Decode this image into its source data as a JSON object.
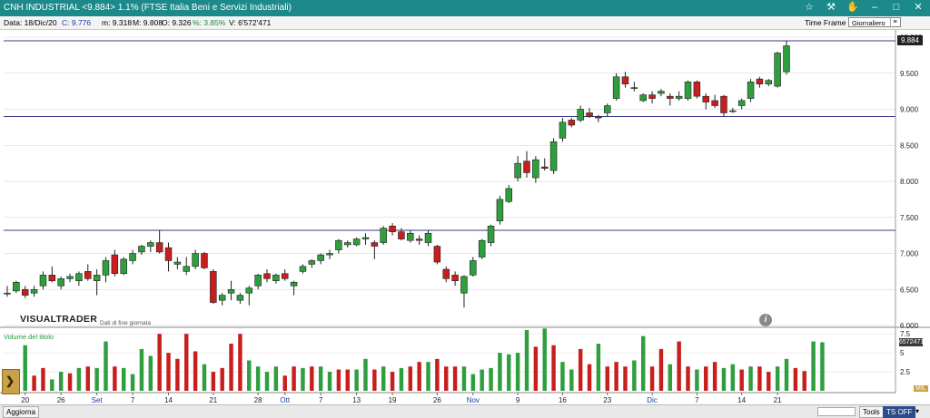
{
  "window": {
    "title": "CNH INDUSTRIAL <9.884> 1.1%  (FTSE Italia Beni e Servizi Industriali)"
  },
  "info": {
    "date_label": "Data: 18/Dic/20",
    "close_label": "C: 9.776",
    "min_label": "m: 9.318",
    "max_label": "M: 9.808",
    "open_label": "O: 9.326",
    "pct_label": "%: 3.85%",
    "vol_label": "V: 6'572'471",
    "time_frame_label": "Time Frame",
    "time_frame_value": "Giornaliero"
  },
  "overlay": {
    "logo": "VISUALTRADER",
    "logo_sub": "Dati di fine giornata",
    "info_icon": "i",
    "volume_title": "Volume del titolo",
    "last_price": "9.884",
    "last_volume": "6572471",
    "mil_label": "MIL"
  },
  "bottom": {
    "update_label": "Aggiorna",
    "tools_label": "Tools",
    "tsoff_label": "TS OFF"
  },
  "icons": {
    "star": "star-icon",
    "hammer": "hammer-icon",
    "hand": "hand-icon",
    "minimize": "minimize-icon",
    "maximize": "maximize-icon",
    "close": "close-icon"
  },
  "colors": {
    "up": "#2e9e3e",
    "down": "#c81e1e",
    "titlebar": "#1c8a8a",
    "hline": "#3a3a8a"
  },
  "chart_data": [
    {
      "type": "candlestick",
      "title": "",
      "ylim": [
        6.0,
        10.0
      ],
      "y_ticks": [
        "10.000",
        "9.500",
        "9.000",
        "8.500",
        "8.000",
        "7.500",
        "7.000",
        "6.500",
        "6.000"
      ],
      "y_tick_values": [
        10.0,
        9.5,
        9.0,
        8.5,
        8.0,
        7.5,
        7.0,
        6.5,
        6.0
      ],
      "horizontal_lines": [
        9.95,
        8.9,
        7.32
      ],
      "x_tick_labels": [
        "20",
        "26",
        "Set",
        "7",
        "14",
        "21",
        "28",
        "Ott",
        "7",
        "13",
        "19",
        "26",
        "Nov",
        "9",
        "16",
        "23",
        "Dic",
        "7",
        "14",
        "21"
      ],
      "x_tick_index": [
        2,
        6,
        10,
        14,
        18,
        23,
        28,
        31,
        35,
        39,
        43,
        48,
        52,
        57,
        62,
        67,
        72,
        77,
        82,
        86
      ],
      "highlighted_ticks": [
        "Set",
        "Ott",
        "Nov",
        "Dic"
      ],
      "candles": [
        {
          "o": 6.45,
          "h": 6.55,
          "l": 6.4,
          "c": 6.45
        },
        {
          "o": 6.48,
          "h": 6.62,
          "l": 6.45,
          "c": 6.6
        },
        {
          "o": 6.5,
          "h": 6.55,
          "l": 6.38,
          "c": 6.42
        },
        {
          "o": 6.45,
          "h": 6.55,
          "l": 6.4,
          "c": 6.5
        },
        {
          "o": 6.55,
          "h": 6.75,
          "l": 6.5,
          "c": 6.7
        },
        {
          "o": 6.7,
          "h": 6.82,
          "l": 6.6,
          "c": 6.62
        },
        {
          "o": 6.55,
          "h": 6.68,
          "l": 6.5,
          "c": 6.65
        },
        {
          "o": 6.65,
          "h": 6.72,
          "l": 6.6,
          "c": 6.68
        },
        {
          "o": 6.62,
          "h": 6.75,
          "l": 6.55,
          "c": 6.72
        },
        {
          "o": 6.75,
          "h": 6.85,
          "l": 6.62,
          "c": 6.65
        },
        {
          "o": 6.62,
          "h": 6.78,
          "l": 6.42,
          "c": 6.7
        },
        {
          "o": 6.7,
          "h": 6.95,
          "l": 6.6,
          "c": 6.9
        },
        {
          "o": 6.98,
          "h": 7.05,
          "l": 6.68,
          "c": 6.72
        },
        {
          "o": 6.72,
          "h": 6.95,
          "l": 6.7,
          "c": 6.92
        },
        {
          "o": 6.9,
          "h": 7.05,
          "l": 6.85,
          "c": 7.0
        },
        {
          "o": 7.02,
          "h": 7.12,
          "l": 6.98,
          "c": 7.1
        },
        {
          "o": 7.1,
          "h": 7.18,
          "l": 7.02,
          "c": 7.15
        },
        {
          "o": 7.15,
          "h": 7.32,
          "l": 7.0,
          "c": 7.02
        },
        {
          "o": 7.08,
          "h": 7.15,
          "l": 6.75,
          "c": 6.9
        },
        {
          "o": 6.85,
          "h": 6.95,
          "l": 6.78,
          "c": 6.88
        },
        {
          "o": 6.75,
          "h": 6.95,
          "l": 6.7,
          "c": 6.82
        },
        {
          "o": 6.82,
          "h": 7.05,
          "l": 6.78,
          "c": 7.0
        },
        {
          "o": 7.0,
          "h": 7.02,
          "l": 6.78,
          "c": 6.8
        },
        {
          "o": 6.75,
          "h": 6.78,
          "l": 6.3,
          "c": 6.32
        },
        {
          "o": 6.35,
          "h": 6.45,
          "l": 6.28,
          "c": 6.42
        },
        {
          "o": 6.45,
          "h": 6.62,
          "l": 6.35,
          "c": 6.5
        },
        {
          "o": 6.35,
          "h": 6.45,
          "l": 6.3,
          "c": 6.42
        },
        {
          "o": 6.45,
          "h": 6.55,
          "l": 6.28,
          "c": 6.52
        },
        {
          "o": 6.55,
          "h": 6.72,
          "l": 6.5,
          "c": 6.7
        },
        {
          "o": 6.72,
          "h": 6.78,
          "l": 6.6,
          "c": 6.65
        },
        {
          "o": 6.62,
          "h": 6.72,
          "l": 6.58,
          "c": 6.7
        },
        {
          "o": 6.72,
          "h": 6.78,
          "l": 6.62,
          "c": 6.65
        },
        {
          "o": 6.55,
          "h": 6.62,
          "l": 6.42,
          "c": 6.6
        },
        {
          "o": 6.75,
          "h": 6.85,
          "l": 6.72,
          "c": 6.82
        },
        {
          "o": 6.85,
          "h": 6.92,
          "l": 6.8,
          "c": 6.9
        },
        {
          "o": 6.9,
          "h": 7.0,
          "l": 6.85,
          "c": 6.98
        },
        {
          "o": 6.98,
          "h": 7.05,
          "l": 6.92,
          "c": 7.0
        },
        {
          "o": 7.05,
          "h": 7.2,
          "l": 7.0,
          "c": 7.18
        },
        {
          "o": 7.12,
          "h": 7.18,
          "l": 7.08,
          "c": 7.15
        },
        {
          "o": 7.12,
          "h": 7.22,
          "l": 7.1,
          "c": 7.2
        },
        {
          "o": 7.2,
          "h": 7.28,
          "l": 7.12,
          "c": 7.22
        },
        {
          "o": 7.15,
          "h": 7.18,
          "l": 6.92,
          "c": 7.1
        },
        {
          "o": 7.15,
          "h": 7.38,
          "l": 7.12,
          "c": 7.35
        },
        {
          "o": 7.38,
          "h": 7.42,
          "l": 7.25,
          "c": 7.3
        },
        {
          "o": 7.3,
          "h": 7.35,
          "l": 7.18,
          "c": 7.2
        },
        {
          "o": 7.18,
          "h": 7.32,
          "l": 7.15,
          "c": 7.28
        },
        {
          "o": 7.2,
          "h": 7.25,
          "l": 7.12,
          "c": 7.18
        },
        {
          "o": 7.15,
          "h": 7.32,
          "l": 7.1,
          "c": 7.28
        },
        {
          "o": 7.1,
          "h": 7.12,
          "l": 6.85,
          "c": 6.88
        },
        {
          "o": 6.78,
          "h": 6.82,
          "l": 6.6,
          "c": 6.65
        },
        {
          "o": 6.7,
          "h": 6.75,
          "l": 6.55,
          "c": 6.62
        },
        {
          "o": 6.45,
          "h": 6.7,
          "l": 6.25,
          "c": 6.68
        },
        {
          "o": 6.7,
          "h": 6.95,
          "l": 6.68,
          "c": 6.9
        },
        {
          "o": 6.95,
          "h": 7.2,
          "l": 6.92,
          "c": 7.18
        },
        {
          "o": 7.15,
          "h": 7.4,
          "l": 7.1,
          "c": 7.38
        },
        {
          "o": 7.45,
          "h": 7.8,
          "l": 7.4,
          "c": 7.75
        },
        {
          "o": 7.72,
          "h": 7.95,
          "l": 7.7,
          "c": 7.9
        },
        {
          "o": 8.05,
          "h": 8.35,
          "l": 8.0,
          "c": 8.25
        },
        {
          "o": 8.28,
          "h": 8.42,
          "l": 8.05,
          "c": 8.12
        },
        {
          "o": 8.05,
          "h": 8.35,
          "l": 7.98,
          "c": 8.3
        },
        {
          "o": 8.2,
          "h": 8.32,
          "l": 8.15,
          "c": 8.18
        },
        {
          "o": 8.15,
          "h": 8.6,
          "l": 8.1,
          "c": 8.55
        },
        {
          "o": 8.6,
          "h": 8.88,
          "l": 8.55,
          "c": 8.82
        },
        {
          "o": 8.85,
          "h": 8.88,
          "l": 8.75,
          "c": 8.78
        },
        {
          "o": 8.85,
          "h": 9.05,
          "l": 8.82,
          "c": 9.0
        },
        {
          "o": 8.95,
          "h": 9.02,
          "l": 8.88,
          "c": 8.9
        },
        {
          "o": 8.9,
          "h": 8.92,
          "l": 8.82,
          "c": 8.88
        },
        {
          "o": 8.95,
          "h": 9.08,
          "l": 8.9,
          "c": 9.05
        },
        {
          "o": 9.15,
          "h": 9.5,
          "l": 9.12,
          "c": 9.45
        },
        {
          "o": 9.45,
          "h": 9.52,
          "l": 9.3,
          "c": 9.35
        },
        {
          "o": 9.3,
          "h": 9.38,
          "l": 9.25,
          "c": 9.3
        },
        {
          "o": 9.12,
          "h": 9.22,
          "l": 9.1,
          "c": 9.2
        },
        {
          "o": 9.2,
          "h": 9.25,
          "l": 9.08,
          "c": 9.15
        },
        {
          "o": 9.22,
          "h": 9.28,
          "l": 9.18,
          "c": 9.25
        },
        {
          "o": 9.18,
          "h": 9.22,
          "l": 9.05,
          "c": 9.15
        },
        {
          "o": 9.15,
          "h": 9.25,
          "l": 9.12,
          "c": 9.18
        },
        {
          "o": 9.15,
          "h": 9.4,
          "l": 9.12,
          "c": 9.38
        },
        {
          "o": 9.38,
          "h": 9.4,
          "l": 9.15,
          "c": 9.18
        },
        {
          "o": 9.18,
          "h": 9.22,
          "l": 9.0,
          "c": 9.1
        },
        {
          "o": 9.12,
          "h": 9.2,
          "l": 9.02,
          "c": 9.05
        },
        {
          "o": 9.18,
          "h": 9.2,
          "l": 8.9,
          "c": 8.95
        },
        {
          "o": 8.98,
          "h": 9.02,
          "l": 8.95,
          "c": 8.98
        },
        {
          "o": 9.05,
          "h": 9.15,
          "l": 9.0,
          "c": 9.12
        },
        {
          "o": 9.15,
          "h": 9.42,
          "l": 9.1,
          "c": 9.38
        },
        {
          "o": 9.42,
          "h": 9.45,
          "l": 9.3,
          "c": 9.35
        },
        {
          "o": 9.35,
          "h": 9.42,
          "l": 9.32,
          "c": 9.4
        },
        {
          "o": 9.32,
          "h": 9.8,
          "l": 9.3,
          "c": 9.78
        },
        {
          "o": 9.52,
          "h": 9.95,
          "l": 9.48,
          "c": 9.88
        }
      ]
    },
    {
      "type": "bar",
      "title": "Volume del titolo",
      "ylim": [
        0,
        8
      ],
      "y_ticks": [
        "7.5",
        "5",
        "2.5"
      ],
      "y_tick_values": [
        7.5,
        5,
        2.5
      ],
      "values": [
        2.3,
        2.2,
        6.0,
        2.0,
        3.0,
        1.5,
        2.5,
        2.3,
        3.0,
        3.2,
        3.0,
        6.5,
        3.2,
        3.0,
        2.2,
        5.5,
        4.6,
        7.5,
        5.0,
        4.2,
        7.5,
        5.2,
        3.5,
        2.5,
        3.0,
        6.2,
        7.5,
        4.0,
        3.2,
        2.5,
        3.2,
        2.0,
        3.2,
        3.0,
        3.2,
        3.2,
        2.5,
        2.8,
        2.8,
        2.8,
        4.2,
        2.8,
        3.2,
        2.5,
        3.0,
        3.2,
        3.8,
        3.8,
        4.2,
        3.2,
        3.2,
        3.2,
        2.2,
        2.8,
        3.0,
        5.0,
        4.8,
        5.0,
        8.0,
        5.8,
        8.2,
        6.0,
        3.8,
        2.8,
        5.5,
        3.5,
        6.2,
        3.2,
        3.8,
        3.2,
        4.0,
        7.2,
        3.2,
        5.5,
        3.5,
        6.5,
        3.2,
        2.8,
        3.2,
        3.8,
        3.0,
        3.5,
        2.8,
        3.2,
        3.2,
        2.5,
        3.2,
        4.2,
        3.0,
        2.6,
        6.5,
        6.4
      ],
      "colors_up": [
        true,
        false,
        true,
        false,
        false,
        true,
        true,
        false,
        true,
        false,
        true,
        true,
        false,
        true,
        true,
        true,
        true,
        false,
        false,
        false,
        false,
        false,
        true,
        false,
        false,
        false,
        false,
        true,
        true,
        true,
        true,
        false,
        false,
        true,
        false,
        true,
        true,
        false,
        false,
        true,
        true,
        false,
        true,
        false,
        true,
        false,
        false,
        true,
        false,
        false,
        false,
        true,
        true,
        true,
        true,
        true,
        true,
        true,
        true,
        false,
        true,
        false,
        true,
        true,
        false,
        false,
        true,
        false,
        false,
        false,
        true,
        true,
        false,
        false,
        true,
        false,
        false,
        true,
        false,
        false,
        true,
        true,
        false,
        true,
        false,
        false,
        true,
        true,
        false,
        false,
        true,
        true
      ]
    }
  ]
}
